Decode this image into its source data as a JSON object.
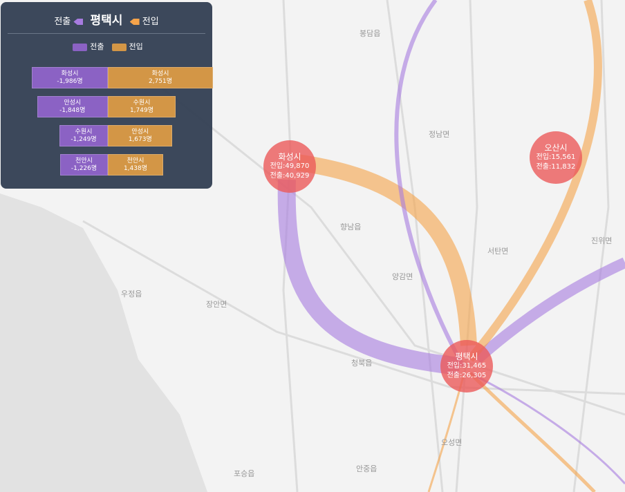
{
  "panel": {
    "out_label": "전출",
    "center": "평택시",
    "in_label": "전입",
    "legend_out": "전출",
    "legend_in": "전입",
    "rows": [
      {
        "out_city": "화성시",
        "out_value": "-1,986명",
        "in_city": "화성시",
        "in_value": "2,751명",
        "out_frac": 1.0,
        "in_frac": 1.0
      },
      {
        "out_city": "안성시",
        "out_value": "-1,848명",
        "in_city": "수원시",
        "in_value": "1,749명",
        "out_frac": 0.93,
        "in_frac": 0.64
      },
      {
        "out_city": "수원시",
        "out_value": "-1,249명",
        "in_city": "안성시",
        "in_value": "1,673명",
        "out_frac": 0.63,
        "in_frac": 0.61
      },
      {
        "out_city": "천안시",
        "out_value": "-1,226명",
        "in_city": "천안시",
        "in_value": "1,438명",
        "out_frac": 0.62,
        "in_frac": 0.52
      }
    ]
  },
  "nodes": [
    {
      "name": "화성시",
      "in": "전입:49,870",
      "out": "전출:40,929"
    },
    {
      "name": "오산시",
      "in": "전입:15,561",
      "out": "전출:11,832"
    },
    {
      "name": "평택시",
      "in": "전입:31,465",
      "out": "전출:26,305"
    }
  ],
  "places": [
    "봉담읍",
    "정남면",
    "향남읍",
    "양감면",
    "서탄면",
    "우정읍",
    "장안면",
    "청북읍",
    "포승읍",
    "오성면",
    "안중읍",
    "진위면"
  ],
  "colors": {
    "out": "#a77be0",
    "in": "#f5a34a",
    "node": "#eb5a5a"
  }
}
